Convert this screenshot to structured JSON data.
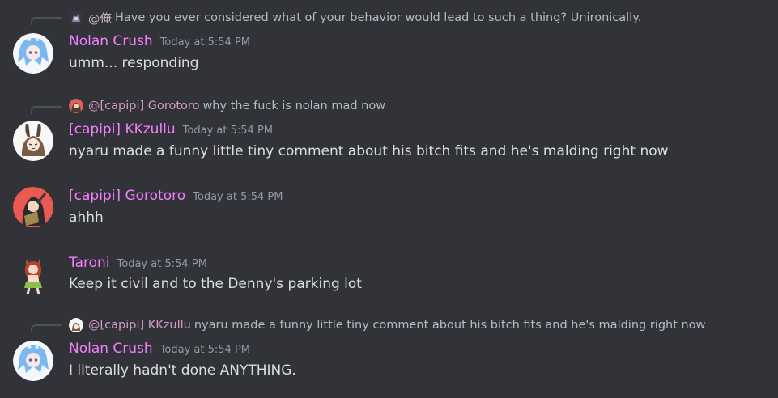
{
  "colors": {
    "background": "#313338",
    "username_pink": "#f47fff",
    "message_text": "#dbdee1",
    "timestamp": "#949ba4",
    "reply_line": "#4e5058"
  },
  "messages": [
    {
      "reply": {
        "avatar_icon": "dark-avatar-icon",
        "name": "@俺",
        "text": "Have you ever considered what of your behavior would lead to such a thing? Unironically."
      },
      "avatar_icon": "blue-anime-avatar-icon",
      "username": "Nolan Crush",
      "timestamp": "Today at 5:54 PM",
      "text": "umm... responding"
    },
    {
      "reply": {
        "avatar_icon": "gorotoro-avatar-icon",
        "name": "@[capipi] Gorotoro",
        "text": "why the fuck is nolan mad now"
      },
      "avatar_icon": "bunny-girl-avatar-icon",
      "username": "[capipi] KKzullu",
      "timestamp": "Today at 5:54 PM",
      "text": "nyaru made a funny little tiny comment about his bitch fits and he's malding right now"
    },
    {
      "avatar_icon": "red-girl-avatar-icon",
      "username": "[capipi] Gorotoro",
      "timestamp": "Today at 5:54 PM",
      "text": "ahhh"
    },
    {
      "avatar_icon": "taroni-avatar-icon",
      "username": "Taroni",
      "timestamp": "Today at 5:54 PM",
      "text": "Keep it civil and to the Denny's parking lot"
    },
    {
      "reply": {
        "avatar_icon": "kkzullu-avatar-icon",
        "name": "@[capipi] KKzullu",
        "text": "nyaru made a funny little tiny comment about his bitch fits and he's malding right now"
      },
      "avatar_icon": "blue-anime-avatar-icon",
      "username": "Nolan Crush",
      "timestamp": "Today at 5:54 PM",
      "text": "I literally hadn't done ANYTHING."
    }
  ]
}
